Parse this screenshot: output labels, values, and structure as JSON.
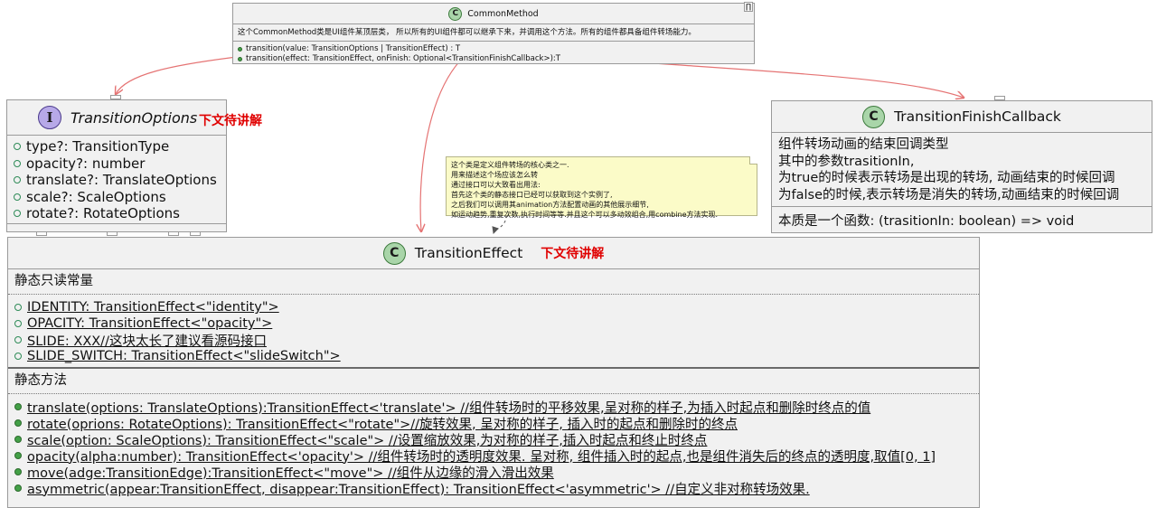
{
  "common_method": {
    "badge": "C",
    "name": "CommonMethod",
    "description": "这个CommonMethod类是UI组件某顶层类， 所以所有的UI组件都可以继承下来，并调用这个方法。所有的组件都具备组件转场能力。",
    "corner_mark": "∏",
    "methods": [
      "transition(value: TransitionOptions | TransitionEffect) : T",
      "transition(effect: TransitionEffect, onFinish: Optional<TransitionFinishCallback>):T"
    ]
  },
  "transition_options": {
    "badge": "I",
    "name": "TransitionOptions",
    "annotation": "下文待讲解",
    "fields": [
      "type?: TransitionType",
      "opacity?: number",
      "translate?: TranslateOptions",
      "scale?: ScaleOptions",
      "rotate?: RotateOptions"
    ]
  },
  "transition_finish_callback": {
    "badge": "C",
    "name": "TransitionFinishCallback",
    "description": [
      "组件转场动画的结束回调类型",
      "其中的参数trasitionIn,",
      "为true的时候表示转场是出现的转场, 动画结束的时候回调",
      "为false的时候,表示转场是消失的转场,动画结束的时候回调"
    ],
    "essence": "本质是一个函数: (trasitionIn: boolean) => void"
  },
  "note": {
    "lines": [
      "这个类是定义组件转场的核心类之一.",
      "用来描述这个场应该怎么转",
      "通过接口可以大致看出用法:",
      "首先这个类的静态接口已经可以获取到这个实例了,",
      "之后我们可以调用其animation方法配置动画的其他展示细节,",
      "如运动趋势,重复次数,执行时间等等.并且这个可以多动效组合,用combine方法实现."
    ]
  },
  "transition_effect": {
    "badge": "C",
    "name": "TransitionEffect",
    "annotation": "下文待讲解",
    "constants_title": "静态只读常量",
    "constants": [
      "IDENTITY: TransitionEffect<\"identity\">",
      "OPACITY: TransitionEffect<\"opacity\">",
      "SLIDE: XXX//这块太长了建议看源码接口",
      "SLIDE_SWITCH: TransitionEffect<\"slideSwitch\">"
    ],
    "methods_title": "静态方法",
    "methods": [
      "translate(options: TranslateOptions):TransitionEffect<'translate'> //组件转场时的平移效果,呈对称的样子,为插入时起点和删除时终点的值",
      "rotate(oprions: RotateOptions): TransitionEffect<\"rotate\">//旋转效果, 呈对称的样子, 插入时的起点和删除时的终点",
      "scale(option: ScaleOptions): TransitionEffect<\"scale\"> //设置缩放效果,为对称的样子,插入时起点和终止时终点",
      "opacity(alpha:number): TransitionEffect<'opacity'> //组件转场时的透明度效果. 呈对称, 组件插入时的起点,也是组件消失后的终点的透明度,取值[0, 1]",
      "move(adge:TransitionEdge):TransitionEffect<\"move\"> //组件从边缘的滑入滑出效果",
      "asymmetric(appear:TransitionEffect, disappear:TransitionEffect): TransitionEffect<'asymmetric'> //自定义非对称转场效果."
    ]
  },
  "colors": {
    "arrow": "#e57373",
    "annotation_red": "#e00000",
    "class_badge": "#a9d5a9",
    "interface_badge": "#b7a9e8",
    "note_bg": "#fbfbc8"
  }
}
